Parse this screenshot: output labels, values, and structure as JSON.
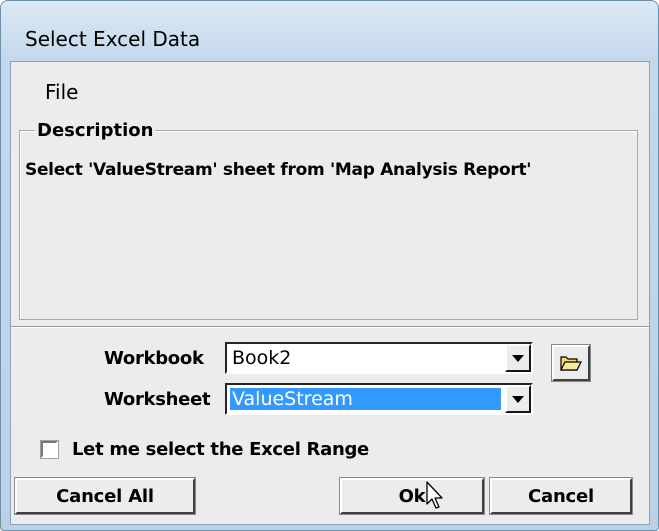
{
  "window": {
    "title": "Select Excel Data"
  },
  "menu": {
    "file": "File"
  },
  "description": {
    "legend": "Description",
    "text": "Select 'ValueStream' sheet from 'Map Analysis Report'"
  },
  "workbook": {
    "label": "Workbook",
    "value": "Book2",
    "folder_icon": "folder-open-icon"
  },
  "worksheet": {
    "label": "Worksheet",
    "value": "ValueStream"
  },
  "range_checkbox": {
    "label": "Let me select the Excel Range",
    "checked": false
  },
  "buttons": {
    "cancel_all": "Cancel All",
    "ok": "Ok",
    "cancel": "Cancel"
  },
  "colors": {
    "selection": "#3399ff",
    "dialog_bg": "#ececec",
    "frame": "#c4d8ec"
  }
}
